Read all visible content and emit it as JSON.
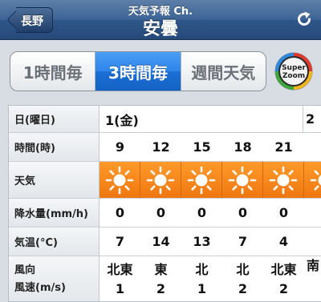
{
  "nav": {
    "back_label": "長野",
    "subtitle": "天気予報 Ch.",
    "title": "安曇"
  },
  "segments": {
    "items": [
      "1時間毎",
      "3時間毎",
      "週間天気"
    ],
    "selected": "3時間毎"
  },
  "zoom_button": {
    "line1": "Super",
    "line2": "Zoom"
  },
  "table": {
    "date_row": {
      "label": "日(曜日)",
      "value": "1(金)",
      "next_partial": "2"
    },
    "time_row": {
      "label": "時間(時)",
      "values": [
        "9",
        "12",
        "15",
        "18",
        "21"
      ]
    },
    "weather_row": {
      "label": "天気",
      "icons": [
        "sun-icon",
        "sun-icon",
        "sun-icon",
        "sun-icon",
        "sun-icon",
        "sun-icon"
      ]
    },
    "precip_row": {
      "label": "降水量(mm/h)",
      "values": [
        "0",
        "0",
        "0",
        "0",
        "0"
      ]
    },
    "temp_row": {
      "label": "気温(°C)",
      "values": [
        "7",
        "14",
        "13",
        "7",
        "4"
      ]
    },
    "wind_row": {
      "label1": "風向",
      "label2": "風速(m/s)",
      "directions": [
        "北東",
        "東",
        "北",
        "北",
        "北東",
        "南"
      ],
      "speeds": [
        "1",
        "2",
        "1",
        "2",
        "2",
        ""
      ]
    }
  },
  "colors": {
    "nav_blue": "#2e5688",
    "segment_active": "#2e86ea",
    "weather_orange": "#f0871a"
  }
}
